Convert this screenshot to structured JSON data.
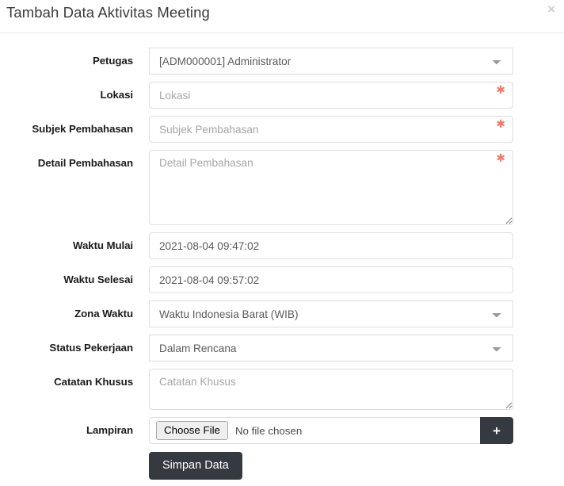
{
  "modal": {
    "title": "Tambah Data Aktivitas Meeting",
    "close_label": "×",
    "required_marker": "✱",
    "accent_dark": "#343a40",
    "required_color": "#f5776a"
  },
  "form": {
    "fields": [
      {
        "key": "petugas",
        "label": "Petugas",
        "type": "select",
        "value": "[ADM000001] Administrator",
        "required": false
      },
      {
        "key": "lokasi",
        "label": "Lokasi",
        "type": "text",
        "value": "",
        "placeholder": "Lokasi",
        "required": true
      },
      {
        "key": "subjek_pembahasan",
        "label": "Subjek Pembahasan",
        "type": "text",
        "value": "",
        "placeholder": "Subjek Pembahasan",
        "required": true
      },
      {
        "key": "detail_pembahasan",
        "label": "Detail Pembahasan",
        "type": "textarea",
        "value": "",
        "placeholder": "Detail Pembahasan",
        "required": true
      },
      {
        "key": "waktu_mulai",
        "label": "Waktu Mulai",
        "type": "text",
        "value": "2021-08-04 09:47:02",
        "required": false
      },
      {
        "key": "waktu_selesai",
        "label": "Waktu Selesai",
        "type": "text",
        "value": "2021-08-04 09:57:02",
        "required": false
      },
      {
        "key": "zona_waktu",
        "label": "Zona Waktu",
        "type": "select",
        "value": "Waktu Indonesia Barat (WIB)",
        "required": false
      },
      {
        "key": "status_pekerjaan",
        "label": "Status Pekerjaan",
        "type": "select",
        "value": "Dalam Rencana",
        "required": false
      },
      {
        "key": "catatan_khusus",
        "label": "Catatan Khusus",
        "type": "textarea",
        "value": "",
        "placeholder": "Catatan Khusus",
        "required": false
      },
      {
        "key": "lampiran",
        "label": "Lampiran",
        "type": "file",
        "required": false
      }
    ],
    "file": {
      "choose_label": "Choose File",
      "no_file_text": "No file chosen",
      "add_label": "+"
    },
    "submit_label": "Simpan Data"
  }
}
